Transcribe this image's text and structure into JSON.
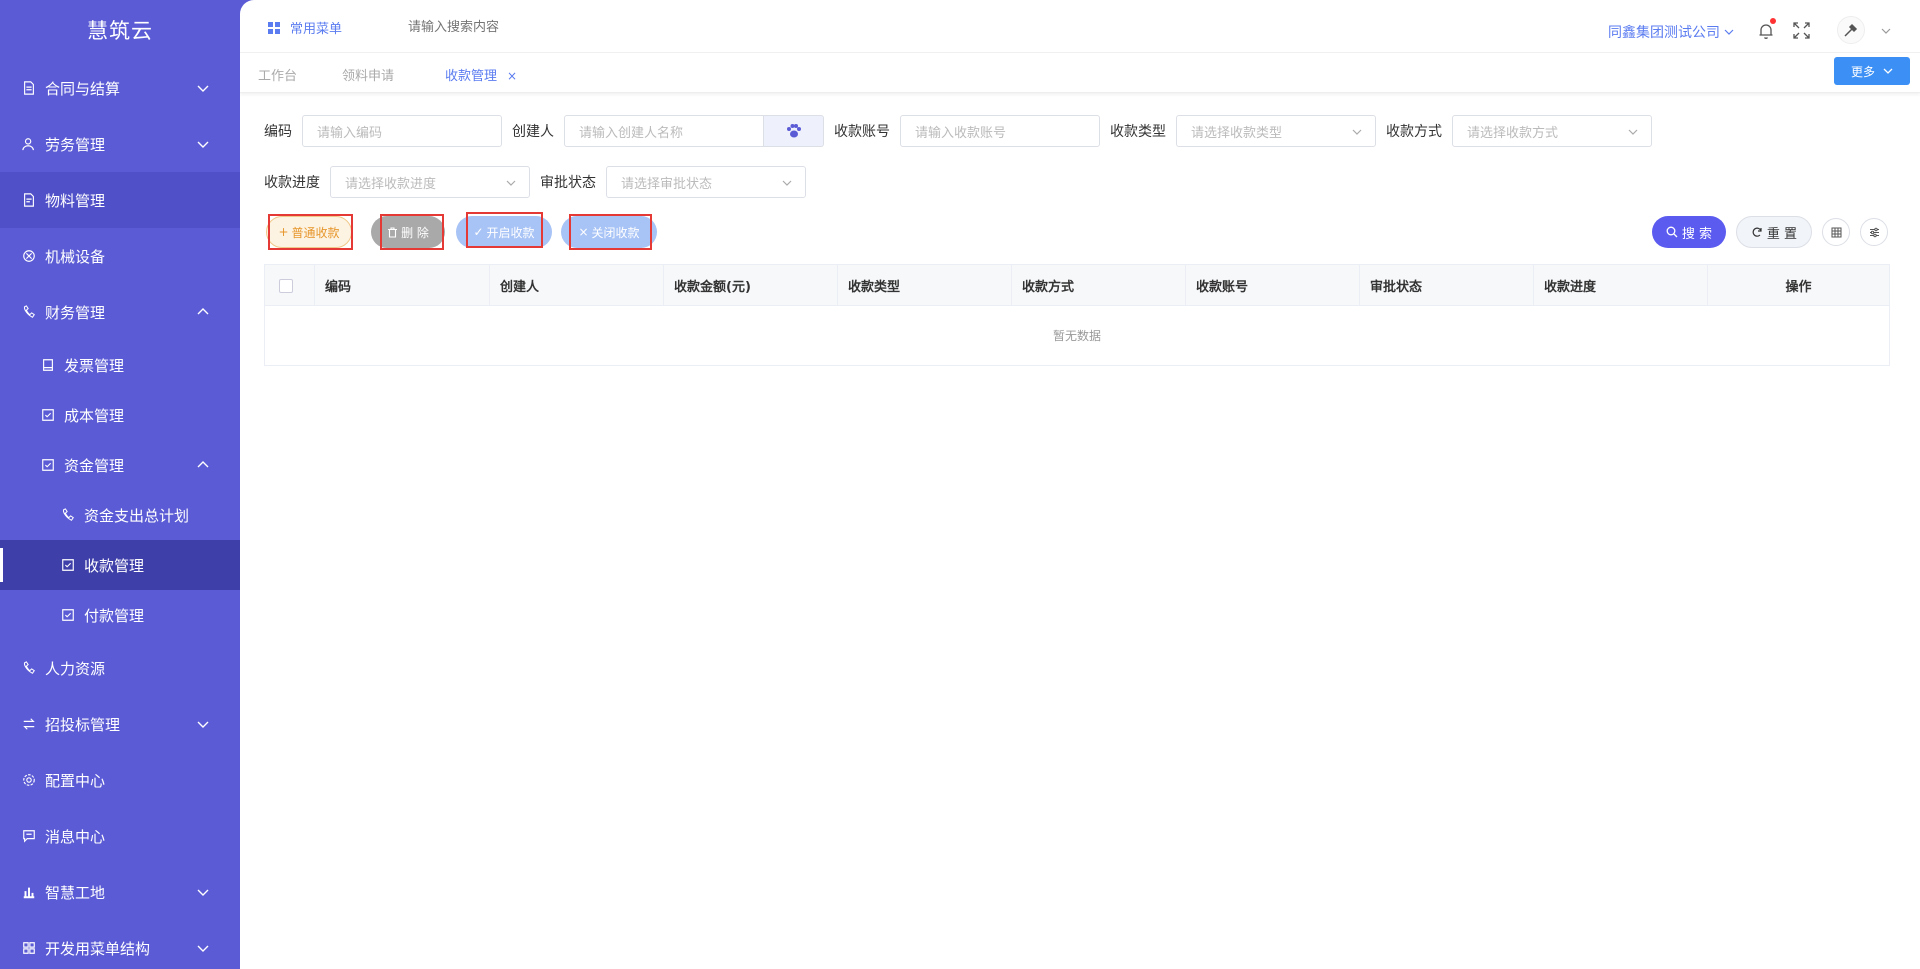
{
  "app": {
    "title": "慧筑云"
  },
  "sidebar": {
    "items": [
      {
        "label": "合同与结算",
        "icon": "contract-icon",
        "expandable": true,
        "expanded": false
      },
      {
        "label": "劳务管理",
        "icon": "labor-icon",
        "expandable": true,
        "expanded": false
      },
      {
        "label": "物料管理",
        "icon": "material-icon",
        "expandable": false
      },
      {
        "label": "机械设备",
        "icon": "machine-icon",
        "expandable": false
      },
      {
        "label": "财务管理",
        "icon": "finance-icon",
        "expandable": true,
        "expanded": true
      },
      {
        "label": "发票管理",
        "icon": "invoice-icon",
        "level": 2
      },
      {
        "label": "成本管理",
        "icon": "cost-icon",
        "level": 2
      },
      {
        "label": "资金管理",
        "icon": "fund-icon",
        "level": 2,
        "expandable": true,
        "expanded": true
      },
      {
        "label": "资金支出总计划",
        "icon": "plan-icon",
        "level": 3
      },
      {
        "label": "收款管理",
        "icon": "receipt-icon",
        "level": 3,
        "active": true
      },
      {
        "label": "付款管理",
        "icon": "payment-icon",
        "level": 3
      },
      {
        "label": "人力资源",
        "icon": "hr-icon",
        "expandable": false
      },
      {
        "label": "招投标管理",
        "icon": "bidding-icon",
        "expandable": true,
        "expanded": false
      },
      {
        "label": "配置中心",
        "icon": "config-icon",
        "expandable": false
      },
      {
        "label": "消息中心",
        "icon": "message-icon",
        "expandable": false
      },
      {
        "label": "智慧工地",
        "icon": "site-icon",
        "expandable": true,
        "expanded": false
      },
      {
        "label": "开发用菜单结构",
        "icon": "dev-menu-icon",
        "expandable": true,
        "expanded": false
      }
    ]
  },
  "header": {
    "favorites_label": "常用菜单",
    "search_placeholder": "请输入搜索内容",
    "company": "同鑫集团测试公司",
    "notification_dot_color": "#ff3333"
  },
  "tabs": {
    "items": [
      {
        "label": "工作台",
        "active": false
      },
      {
        "label": "领料申请",
        "active": false
      },
      {
        "label": "收款管理",
        "active": true,
        "closable": true
      }
    ],
    "close_glyph": "×",
    "more_label": "更多"
  },
  "filters": {
    "code": {
      "label": "编码",
      "placeholder": "请输入编码"
    },
    "creator": {
      "label": "创建人",
      "placeholder": "请输入创建人名称"
    },
    "account": {
      "label": "收款账号",
      "placeholder": "请输入收款账号"
    },
    "type": {
      "label": "收款类型",
      "placeholder": "请选择收款类型"
    },
    "method": {
      "label": "收款方式",
      "placeholder": "请选择收款方式"
    },
    "progress": {
      "label": "收款进度",
      "placeholder": "请选择收款进度"
    },
    "approval": {
      "label": "审批状态",
      "placeholder": "请选择审批状态"
    }
  },
  "actions": {
    "normal_receipt": {
      "icon": "+",
      "label": "普通收款"
    },
    "delete": {
      "label": "删 除"
    },
    "open_receipt": {
      "icon": "✓",
      "label": "开启收款"
    },
    "close_receipt": {
      "icon": "×",
      "label": "关闭收款"
    },
    "search": {
      "label": "搜 索"
    },
    "reset": {
      "label": "重 置"
    }
  },
  "table": {
    "columns": [
      "编码",
      "创建人",
      "收款金额(元)",
      "收款类型",
      "收款方式",
      "收款账号",
      "审批状态",
      "收款进度",
      "操作"
    ],
    "rows": [],
    "empty_text": "暂无数据"
  },
  "colors": {
    "sidebar": "#5b5bd6",
    "sidebar_active": "#3f3faa",
    "accent": "#5b7cf0",
    "primary_button": "#3b8ff5",
    "search_button": "#5b5bf0",
    "highlight_outline": "#e53935"
  }
}
